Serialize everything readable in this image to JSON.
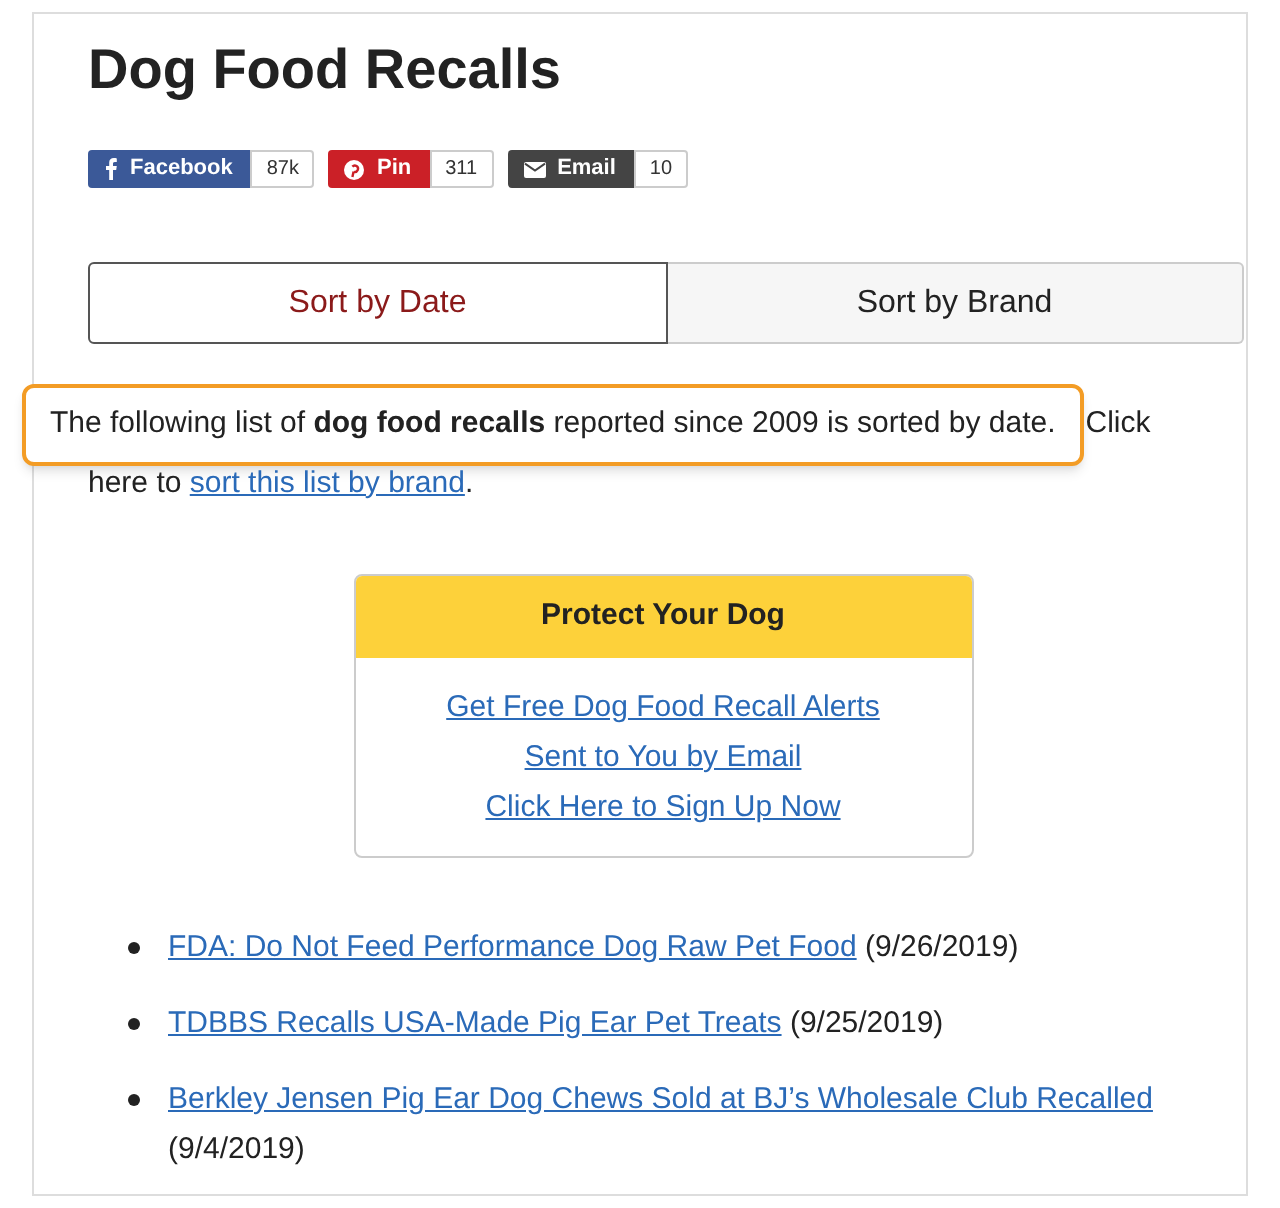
{
  "title": "Dog Food Recalls",
  "share_buttons": [
    {
      "kind": "facebook",
      "label": "Facebook",
      "count": "87k",
      "color": "#3b5998"
    },
    {
      "kind": "pinterest",
      "label": "Pin",
      "count": "311",
      "color": "#cb2027"
    },
    {
      "kind": "email",
      "label": "Email",
      "count": "10",
      "color": "#444444"
    }
  ],
  "tabs": [
    {
      "label": "Sort by Date",
      "selected": true
    },
    {
      "label": "Sort by Brand",
      "selected": false
    }
  ],
  "intro": {
    "highlight": "The following list of **dog food recalls** reported since 2009 is sorted by date.",
    "after_highlight": "Click",
    "line_2_start": "here to",
    "link": "sort this list by brand",
    "end": "."
  },
  "signup_box": {
    "title": "Protect Your Dog",
    "links": [
      "Get Free Dog Food Recall Alerts",
      "Sent to You by Email",
      "Click Here to Sign Up Now"
    ]
  },
  "recalls": [
    {
      "title": "FDA: Do Not Feed Performance Dog Raw Pet Food",
      "date": "(9/26/2019)"
    },
    {
      "title": "TDBBS Recalls USA-Made Pig Ear Pet Treats",
      "date": "(9/25/2019)"
    },
    {
      "title": "Berkley Jensen Pig Ear Dog Chews Sold at BJ’s Wholesale Club Recalled",
      "date": "(9/4/2019)"
    }
  ]
}
